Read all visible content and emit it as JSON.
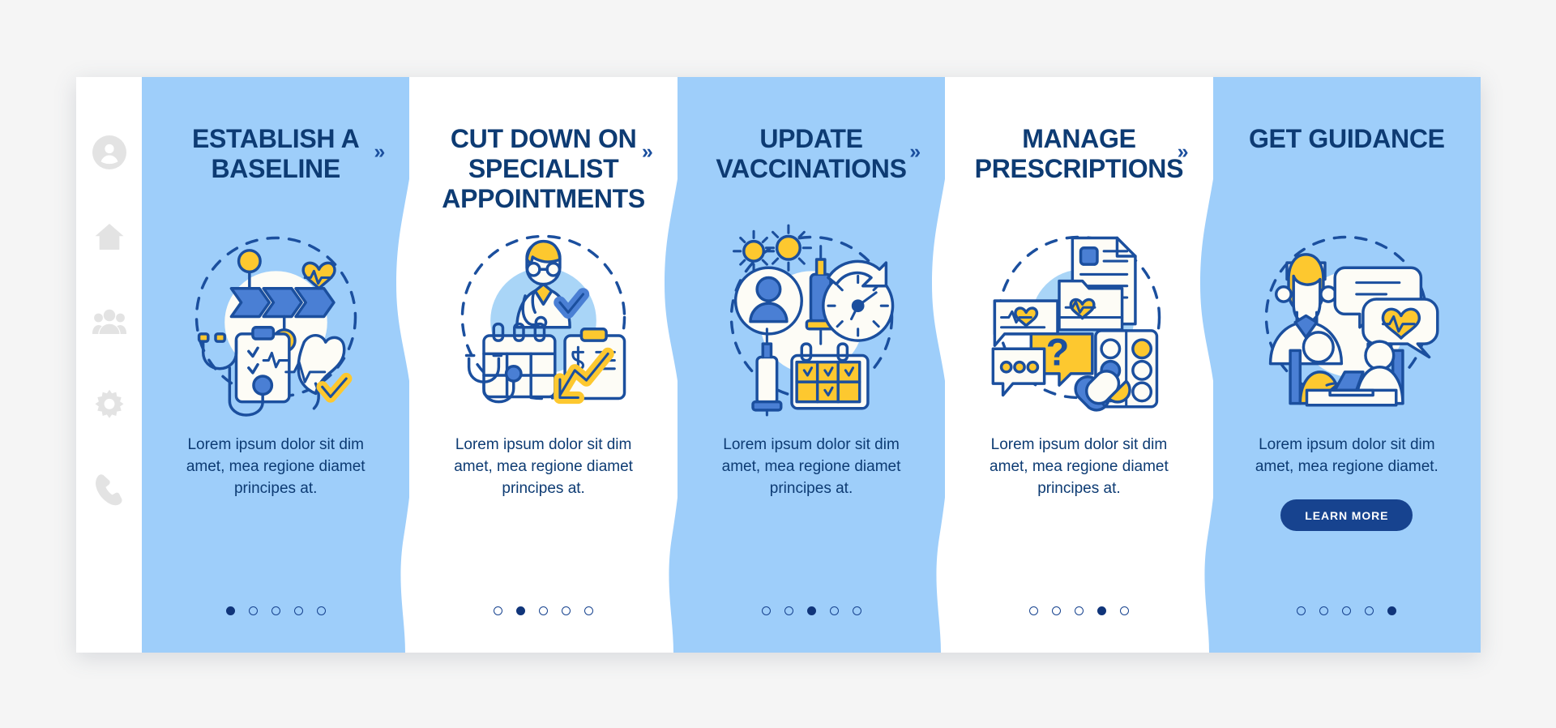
{
  "theme": {
    "page_background": "#f5f5f5",
    "panel_blue": "#9ecefa",
    "panel_white": "#ffffff",
    "title_navy": "#0d3b73",
    "accent_blue": "#17438f",
    "accent_yellow": "#fdc82f",
    "mid_blue": "#4a7fd4",
    "sidebar_icon_grey": "#e3e3e3"
  },
  "sidebar": {
    "items": [
      {
        "icon": "user-avatar-icon",
        "label": "Profile"
      },
      {
        "icon": "home-icon",
        "label": "Home"
      },
      {
        "icon": "people-group-icon",
        "label": "Community"
      },
      {
        "icon": "gear-icon",
        "label": "Settings"
      },
      {
        "icon": "phone-icon",
        "label": "Contact"
      }
    ]
  },
  "separator": {
    "chevron": "»"
  },
  "panels": [
    {
      "id": "establish-a-baseline",
      "background": "blue",
      "title": "ESTABLISH A BASELINE",
      "illustration": "baseline-health-chart-illustration",
      "body": "Lorem ipsum dolor sit dim amet, mea regione diamet principes at.",
      "dots": {
        "count": 5,
        "active_index": 0
      },
      "cta": null
    },
    {
      "id": "cut-down-on-specialist-appointments",
      "background": "white",
      "title": "CUT DOWN ON SPECIALIST APPOINTMENTS",
      "illustration": "doctor-calendar-cost-illustration",
      "body": "Lorem ipsum dolor sit dim amet, mea regione diamet principes at.",
      "dots": {
        "count": 5,
        "active_index": 1
      },
      "cta": null
    },
    {
      "id": "update-vaccinations",
      "background": "blue",
      "title": "UPDATE VACCINATIONS",
      "illustration": "vaccination-syringe-calendar-illustration",
      "body": "Lorem ipsum dolor sit dim amet, mea regione diamet principes at.",
      "dots": {
        "count": 5,
        "active_index": 2
      },
      "cta": null
    },
    {
      "id": "manage-prescriptions",
      "background": "white",
      "title": "MANAGE PRESCRIPTIONS",
      "illustration": "prescription-pills-chat-illustration",
      "body": "Lorem ipsum dolor sit dim amet, mea regione diamet principes at.",
      "dots": {
        "count": 5,
        "active_index": 3
      },
      "cta": null
    },
    {
      "id": "get-guidance",
      "background": "blue",
      "title": "GET GUIDANCE",
      "illustration": "nurse-consultation-illustration",
      "body": "Lorem ipsum dolor sit dim amet, mea regione diamet.",
      "dots": {
        "count": 5,
        "active_index": 4
      },
      "cta": {
        "label": "LEARN MORE"
      }
    }
  ]
}
